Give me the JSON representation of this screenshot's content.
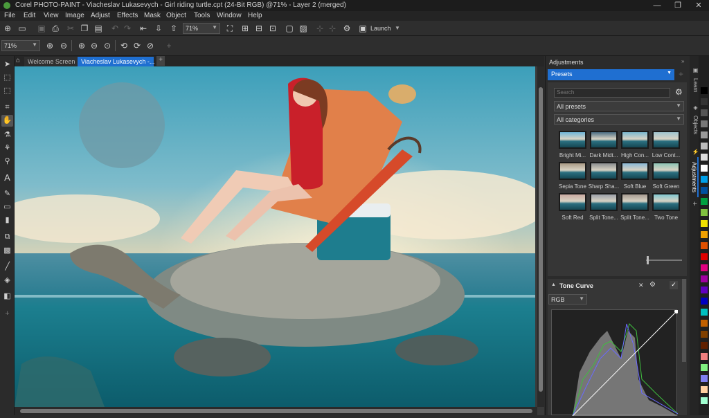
{
  "window": {
    "title": "Corel PHOTO-PAINT - Viacheslav Lukasevych - Girl riding turtle.cpt (24-Bit RGB) @71% - Layer 2 (merged)"
  },
  "menu": [
    "File",
    "Edit",
    "View",
    "Image",
    "Adjust",
    "Effects",
    "Mask",
    "Object",
    "Tools",
    "Window",
    "Help"
  ],
  "toolbar": {
    "zoom_value": "71%",
    "launch_label": "Launch"
  },
  "toolbar2": {
    "zoom_value": "71%"
  },
  "doc_tabs": [
    {
      "label": "Welcome Screen"
    },
    {
      "label": "Viacheslav Lukasevych -..."
    }
  ],
  "adjustments": {
    "header": "Adjustments",
    "dropdown": "Presets",
    "search_placeholder": "Search",
    "filter1": "All presets",
    "filter2": "All categories",
    "presets": [
      "Bright Mi...",
      "Dark Midt...",
      "High Con...",
      "Low Cont...",
      "Sepia Tone",
      "Sharp Sha...",
      "Soft Blue",
      "Soft Green",
      "Soft Red",
      "Split Tone...",
      "Split Tone...",
      "Two Tone"
    ]
  },
  "tone_curve": {
    "title": "Tone Curve",
    "channel": "RGB"
  },
  "side_tabs": [
    "Learn",
    "Objects",
    "Adjustments"
  ],
  "colors": {
    "accent": "#1f6fd1",
    "panel": "#2b2b2b"
  }
}
